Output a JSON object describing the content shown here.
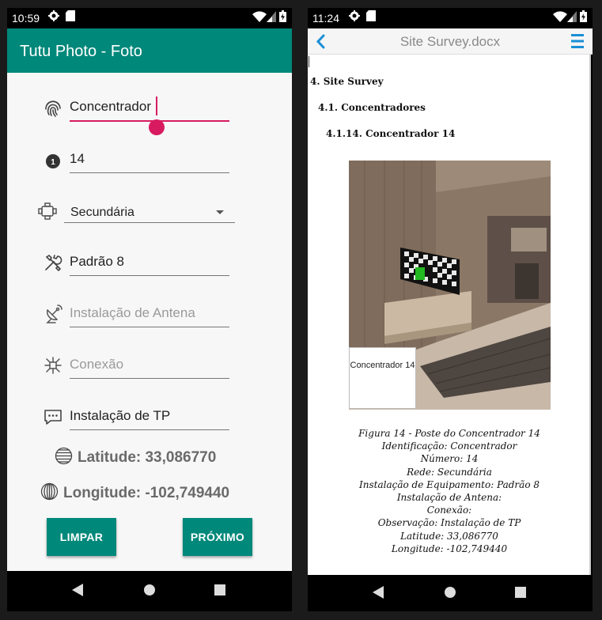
{
  "left": {
    "status": {
      "time": "10:59"
    },
    "app_title": "Tutu Photo - Foto",
    "fields": {
      "identificacao": {
        "value": "Concentrador",
        "icon": "fingerprint-icon"
      },
      "numero": {
        "value": "14",
        "icon": "number-one-icon"
      },
      "rede": {
        "value": "Secundária",
        "icon": "network-node-icon"
      },
      "equipamento": {
        "value": "Padrão 8",
        "icon": "tools-icon"
      },
      "antena": {
        "value": "",
        "placeholder": "Instalação de Antena",
        "icon": "satellite-dish-icon"
      },
      "conexao": {
        "value": "",
        "placeholder": "Conexão",
        "icon": "hub-icon"
      },
      "observacao": {
        "value": "Instalação de TP",
        "icon": "chat-bubble-icon"
      }
    },
    "latitude": "Latitude: 33,086770",
    "longitude": "Longitude: -102,749440",
    "buttons": {
      "limpar": "LIMPAR",
      "proximo": "PRÓXIMO"
    },
    "accent_color": "#00887a",
    "cursor_color": "#d81b60"
  },
  "right": {
    "status": {
      "time": "11:24"
    },
    "doc_title": "Site Survey.docx",
    "headings": {
      "h1": "4. Site Survey",
      "h2": "4.1. Concentradores",
      "h3": "4.1.14. Concentrador 14"
    },
    "photo_label": "Concentrador 14",
    "caption": [
      "Figura 14 - Poste do Concentrador 14",
      "Identificação: Concentrador",
      "Número: 14",
      "Rede: Secundária",
      "Instalação de Equipamento: Padrão 8",
      "Instalação de Antena:",
      "Conexão:",
      "Observação: Instalação de TP",
      "Latitude: 33,086770",
      "Longitude: -102,749440"
    ],
    "accent_color": "#1a8fd6"
  }
}
